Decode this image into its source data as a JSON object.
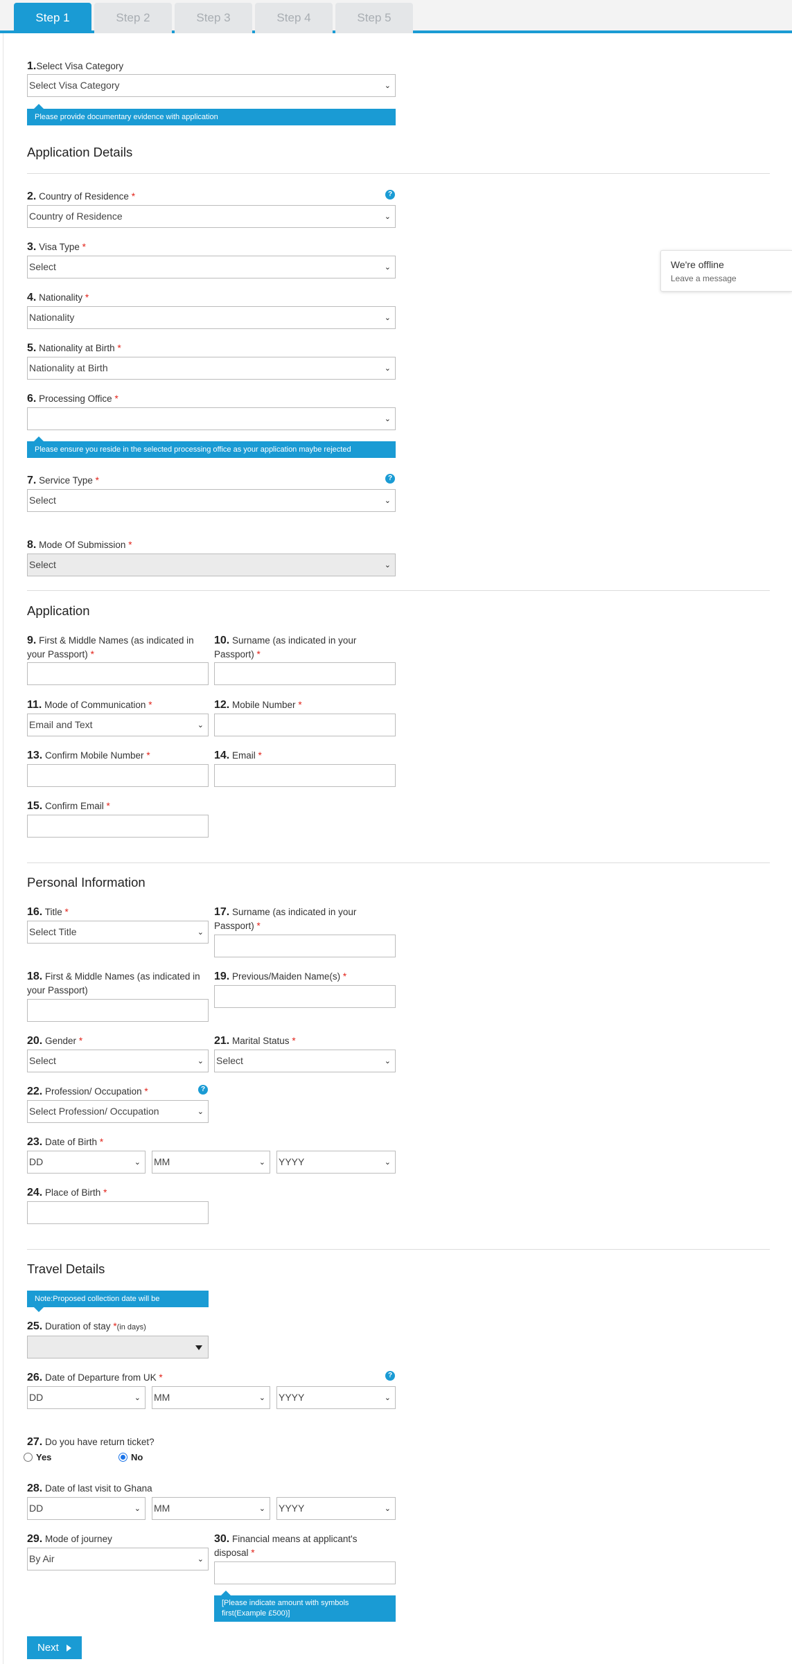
{
  "steps": [
    "Step 1",
    "Step 2",
    "Step 3",
    "Step 4",
    "Step 5"
  ],
  "chat": {
    "status": "We're offline",
    "action": "Leave a message"
  },
  "f1": {
    "num": "1.",
    "label": "Select Visa Category",
    "value": "Select Visa Category",
    "tip": "Please provide documentary evidence with application"
  },
  "sections": {
    "application_details": "Application Details",
    "application": "Application",
    "personal": "Personal Information",
    "travel": "Travel Details"
  },
  "help_glyph": "?",
  "required_mark": "*",
  "chevron": "⌄",
  "f2": {
    "num": "2.",
    "label": "Country of Residence",
    "value": "Country of Residence"
  },
  "f3": {
    "num": "3.",
    "label": "Visa Type",
    "value": "Select"
  },
  "f4": {
    "num": "4.",
    "label": "Nationality",
    "value": "Nationality"
  },
  "f5": {
    "num": "5.",
    "label": "Nationality at Birth",
    "value": "Nationality at Birth"
  },
  "f6": {
    "num": "6.",
    "label": "Processing Office",
    "value": "",
    "tip": "Please ensure you reside in the selected processing office as your application maybe rejected"
  },
  "f7": {
    "num": "7.",
    "label": "Service Type",
    "value": "Select"
  },
  "f8": {
    "num": "8.",
    "label": "Mode Of Submission",
    "value": "Select"
  },
  "f9": {
    "num": "9.",
    "label_l1": "First & Middle Names (as indicated in",
    "label_l2": "your Passport)"
  },
  "f10": {
    "num": "10.",
    "label_l1": "Surname (as indicated in your",
    "label_l2": "Passport)"
  },
  "f11": {
    "num": "11.",
    "label": "Mode of Communication",
    "value": "Email and Text"
  },
  "f12": {
    "num": "12.",
    "label": "Mobile Number"
  },
  "f13": {
    "num": "13.",
    "label": "Confirm Mobile Number"
  },
  "f14": {
    "num": "14.",
    "label": "Email"
  },
  "f15": {
    "num": "15.",
    "label": "Confirm Email"
  },
  "f16": {
    "num": "16.",
    "label": "Title",
    "value": "Select Title"
  },
  "f17": {
    "num": "17.",
    "label_l1": "Surname (as indicated in your",
    "label_l2": "Passport)"
  },
  "f18": {
    "num": "18.",
    "label_l1": "First & Middle Names (as indicated in",
    "label_l2": "your Passport)"
  },
  "f19": {
    "num": "19.",
    "label": "Previous/Maiden Name(s)"
  },
  "f20": {
    "num": "20.",
    "label": "Gender",
    "value": "Select"
  },
  "f21": {
    "num": "21.",
    "label": "Marital Status",
    "value": "Select"
  },
  "f22": {
    "num": "22.",
    "label": "Profession/ Occupation",
    "value": "Select Profession/ Occupation"
  },
  "f23": {
    "num": "23.",
    "label": "Date of Birth",
    "dd": "DD",
    "mm": "MM",
    "yyyy": "YYYY"
  },
  "f24": {
    "num": "24.",
    "label": "Place of Birth"
  },
  "travel_note": "Note:Proposed collection date will be",
  "f25": {
    "num": "25.",
    "label": "Duration of stay",
    "suffix": "(in days)"
  },
  "f26": {
    "num": "26.",
    "label": "Date of Departure from UK",
    "dd": "DD",
    "mm": "MM",
    "yyyy": "YYYY"
  },
  "f27": {
    "num": "27.",
    "label": "Do you have return ticket?",
    "yes": "Yes",
    "no": "No",
    "selected": "No"
  },
  "f28": {
    "num": "28.",
    "label": "Date of last visit to Ghana",
    "dd": "DD",
    "mm": "MM",
    "yyyy": "YYYY"
  },
  "f29": {
    "num": "29.",
    "label": "Mode of journey",
    "value": "By Air"
  },
  "f30": {
    "num": "30.",
    "label_l1": "Financial means at applicant's",
    "label_l2": "disposal",
    "tip_l1": "[Please indicate amount with symbols",
    "tip_l2": "first(Example £500)]"
  },
  "next_button": "Next",
  "colors": {
    "accent": "#1a9bd4",
    "required": "#e2231a"
  }
}
